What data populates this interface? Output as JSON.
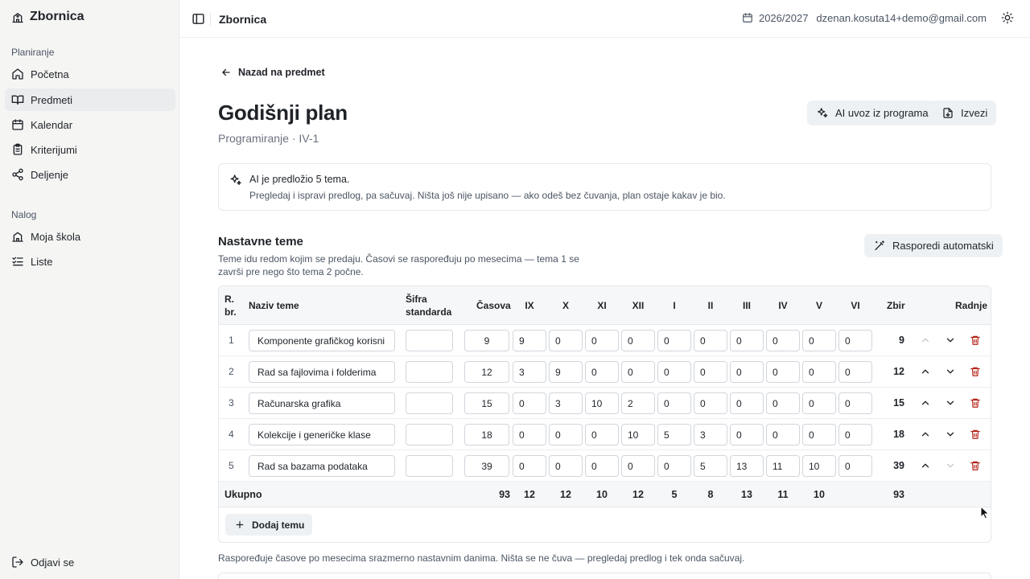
{
  "app": {
    "name": "Zbornica",
    "logout_label": "Odjavi se"
  },
  "sidebar": {
    "section_planning": "Planiranje",
    "planning_items": [
      {
        "label": "Početna",
        "icon": "home-icon"
      },
      {
        "label": "Predmeti",
        "icon": "book-icon",
        "active": true
      },
      {
        "label": "Kalendar",
        "icon": "calendar-icon"
      },
      {
        "label": "Kriterijumi",
        "icon": "clipboard-icon"
      },
      {
        "label": "Deljenje",
        "icon": "share-icon"
      }
    ],
    "section_account": "Nalog",
    "account_items": [
      {
        "label": "Moja škola",
        "icon": "school-icon"
      },
      {
        "label": "Liste",
        "icon": "list-check-icon"
      }
    ]
  },
  "topbar": {
    "title": "Zbornica",
    "school_year": "2026/2027",
    "user_email": "dzenan.kosuta14+demo@gmail.com"
  },
  "page": {
    "back_label": "Nazad na predmet",
    "title": "Godišnji plan",
    "subtitle": "Programiranje · IV-1",
    "ai_import_label": "AI uvoz iz programa",
    "export_label": "Izvezi"
  },
  "notice": {
    "line1": "AI je predložio 5 tema.",
    "line2": "Pregledaj i ispravi predlog, pa sačuvaj. Ništa još nije upisano — ako odeš bez čuvanja, plan ostaje kakav je bio."
  },
  "topics": {
    "title": "Nastavne teme",
    "description": "Teme idu redom kojim se predaju. Časovi se raspoređuju po mesecima — tema 1 se završi pre nego što tema 2 počne.",
    "auto_label": "Rasporedi automatski",
    "headers": {
      "rb_line1": "R.",
      "rb_line2": "br.",
      "name": "Naziv teme",
      "code_line1": "Šifra",
      "code_line2": "standarda",
      "hours": "Časova",
      "months": [
        "IX",
        "X",
        "XI",
        "XII",
        "I",
        "II",
        "III",
        "IV",
        "V",
        "VI"
      ],
      "total": "Zbir",
      "actions": "Radnje"
    },
    "rows": [
      {
        "rb": "1",
        "name": "Komponente grafičkog korisni",
        "code": "",
        "hours": "9",
        "months": [
          "9",
          "0",
          "0",
          "0",
          "0",
          "0",
          "0",
          "0",
          "0",
          "0"
        ],
        "total": "9"
      },
      {
        "rb": "2",
        "name": "Rad sa fajlovima i folderima",
        "code": "",
        "hours": "12",
        "months": [
          "3",
          "9",
          "0",
          "0",
          "0",
          "0",
          "0",
          "0",
          "0",
          "0"
        ],
        "total": "12"
      },
      {
        "rb": "3",
        "name": "Računarska grafika",
        "code": "",
        "hours": "15",
        "months": [
          "0",
          "3",
          "10",
          "2",
          "0",
          "0",
          "0",
          "0",
          "0",
          "0"
        ],
        "total": "15"
      },
      {
        "rb": "4",
        "name": "Kolekcije i generičke klase",
        "code": "",
        "hours": "18",
        "months": [
          "0",
          "0",
          "0",
          "10",
          "5",
          "3",
          "0",
          "0",
          "0",
          "0"
        ],
        "total": "18"
      },
      {
        "rb": "5",
        "name": "Rad sa bazama podataka",
        "code": "",
        "hours": "39",
        "months": [
          "0",
          "0",
          "0",
          "0",
          "0",
          "5",
          "13",
          "11",
          "10",
          "0"
        ],
        "total": "39"
      }
    ],
    "summary": {
      "label": "Ukupno",
      "hours": "93",
      "months": [
        "12",
        "12",
        "10",
        "12",
        "5",
        "8",
        "13",
        "11",
        "10",
        ""
      ],
      "total": "93"
    },
    "add_label": "Dodaj temu",
    "footnote": "Raspoređuje časove po mesecima srazmerno nastavnim danima. Ništa se ne čuva — pregledaj predlog i tek onda sačuvaj."
  }
}
